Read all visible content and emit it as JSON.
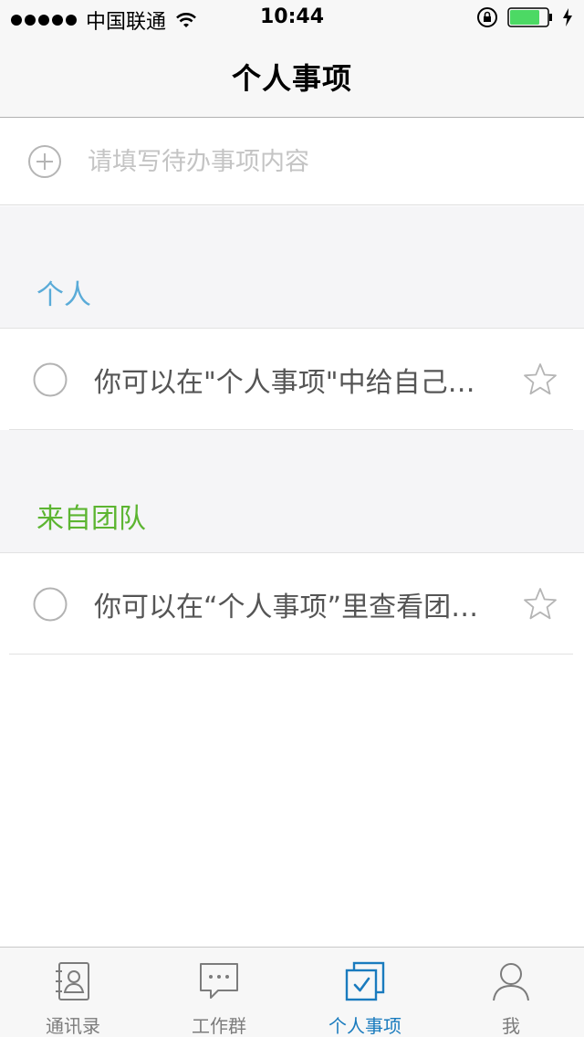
{
  "status_bar": {
    "carrier": "中国联通",
    "time": "10:44",
    "signal_icon": "signal-dots-icon",
    "wifi_icon": "wifi-icon",
    "battery_color": "#4cd964"
  },
  "nav": {
    "title": "个人事项"
  },
  "add_todo": {
    "icon": "plus-circle-icon",
    "placeholder": "请填写待办事项内容",
    "value": ""
  },
  "sections": [
    {
      "title": "个人",
      "title_color": "#5aabd8",
      "items": [
        {
          "text": "你可以在\"个人事项\"中给自己添加待办事项",
          "checked": false,
          "starred": false
        }
      ]
    },
    {
      "title": "来自团队",
      "title_color": "#5cb531",
      "items": [
        {
          "text": "你可以在“个人事项”里查看团队事项",
          "checked": false,
          "starred": false
        }
      ]
    }
  ],
  "tab_bar": {
    "active_color": "#1a7bbe",
    "inactive_color": "#7c7c7c",
    "tabs": [
      {
        "label": "通讯录",
        "icon": "contacts-book-icon",
        "active": false
      },
      {
        "label": "工作群",
        "icon": "chat-bubble-icon",
        "active": false
      },
      {
        "label": "个人事项",
        "icon": "todo-check-icon",
        "active": true
      },
      {
        "label": "我",
        "icon": "person-icon",
        "active": false
      }
    ]
  }
}
